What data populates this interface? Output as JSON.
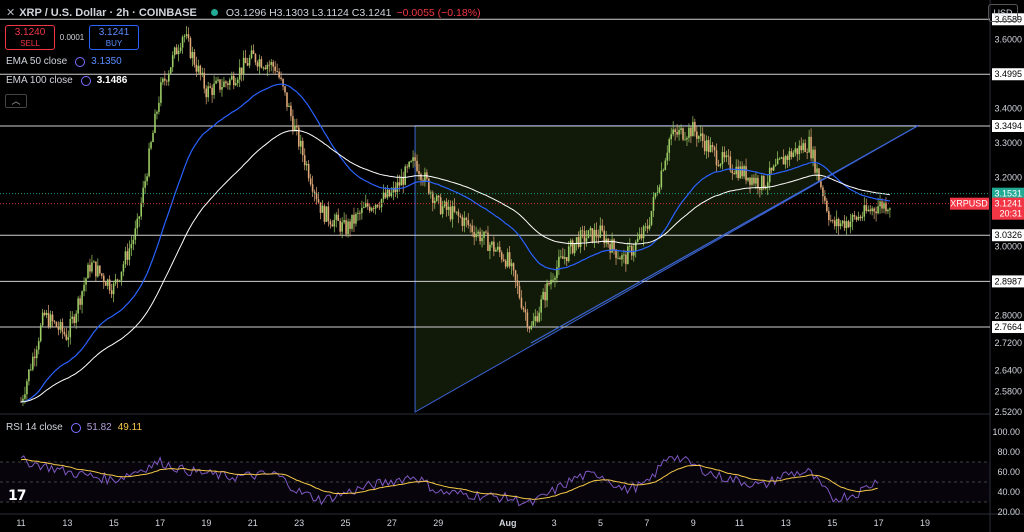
{
  "header": {
    "symbol": "XRP / U.S. Dollar · 2h · COINBASE",
    "ohlc": "O3.1296 H3.1303 L3.1124 C3.1241",
    "change": "−0.0055 (−0.18%)"
  },
  "trade": {
    "sell_price": "3.1240",
    "sell_label": "SELL",
    "spread": "0.0001",
    "buy_price": "3.1241",
    "buy_label": "BUY"
  },
  "indicators": {
    "ema50_label": "EMA 50 close",
    "ema50_value": "3.1350",
    "ema50_color": "#2962ff",
    "ema100_label": "EMA 100 close",
    "ema100_value": "3.1486",
    "ema100_color": "#ffffff"
  },
  "currency": "USD",
  "rsi": {
    "label": "RSI 14 close",
    "value": "51.82",
    "ma_value": "49.11",
    "line_color": "#7e57c2",
    "ma_color": "#f7c948"
  },
  "price_axis": {
    "ticks": [
      "3.6000",
      "3.5000",
      "3.4000",
      "3.3000",
      "3.2000",
      "3.1000",
      "3.0000",
      "2.9000",
      "2.8000",
      "2.7200",
      "2.6400",
      "2.5800",
      "2.5200"
    ],
    "levels": [
      "3.6589",
      "3.4995",
      "3.3494",
      "3.0326",
      "2.8987",
      "2.7664"
    ],
    "green_tag": "3.1531",
    "symbol_tag": "XRPUSD",
    "last_price": "3.1241",
    "countdown": "20:31"
  },
  "rsi_axis": {
    "ticks": [
      "100.00",
      "80.00",
      "60.00",
      "40.00",
      "20.00"
    ]
  },
  "time_axis": {
    "labels": [
      "11",
      "13",
      "15",
      "17",
      "19",
      "21",
      "23",
      "25",
      "27",
      "29",
      "Aug",
      "3",
      "5",
      "7",
      "9",
      "11",
      "13",
      "15",
      "17",
      "19"
    ]
  },
  "chart_data": {
    "type": "candlestick",
    "interval": "2h",
    "price_range": [
      2.52,
      3.68
    ],
    "horizontal_levels": [
      3.6589,
      3.4995,
      3.3494,
      3.0326,
      2.8987,
      2.7664
    ],
    "triangle": {
      "top_left": [
        "Jul 28",
        3.35
      ],
      "top_right": [
        "Aug 18",
        3.35
      ],
      "bottom_left": [
        "Jul 28",
        2.52
      ]
    },
    "trendline": {
      "from": [
        "Aug 2",
        2.72
      ],
      "to": [
        "Aug 18",
        3.35
      ]
    },
    "anchors": [
      [
        "Jul 11",
        2.55
      ],
      [
        "Jul 12",
        2.8
      ],
      [
        "Jul 13",
        2.74
      ],
      [
        "Jul 14",
        2.95
      ],
      [
        "Jul 15",
        2.88
      ],
      [
        "Jul 16",
        3.05
      ],
      [
        "Jul 17",
        3.45
      ],
      [
        "Jul 18",
        3.62
      ],
      [
        "Jul 19",
        3.45
      ],
      [
        "Jul 20",
        3.48
      ],
      [
        "Jul 21",
        3.55
      ],
      [
        "Jul 22",
        3.52
      ],
      [
        "Jul 23",
        3.3
      ],
      [
        "Jul 24",
        3.1
      ],
      [
        "Jul 25",
        3.05
      ],
      [
        "Jul 26",
        3.12
      ],
      [
        "Jul 27",
        3.15
      ],
      [
        "Jul 28",
        3.25
      ],
      [
        "Jul 29",
        3.12
      ],
      [
        "Jul 30",
        3.08
      ],
      [
        "Jul 31",
        3.02
      ],
      [
        "Aug 1",
        2.96
      ],
      [
        "Aug 2",
        2.76
      ],
      [
        "Aug 3",
        2.93
      ],
      [
        "Aug 4",
        3.02
      ],
      [
        "Aug 5",
        3.04
      ],
      [
        "Aug 6",
        2.96
      ],
      [
        "Aug 7",
        3.05
      ],
      [
        "Aug 8",
        3.32
      ],
      [
        "Aug 9",
        3.34
      ],
      [
        "Aug 10",
        3.26
      ],
      [
        "Aug 11",
        3.22
      ],
      [
        "Aug 12",
        3.18
      ],
      [
        "Aug 13",
        3.26
      ],
      [
        "Aug 14",
        3.3
      ],
      [
        "Aug 15",
        3.06
      ],
      [
        "Aug 16",
        3.08
      ],
      [
        "Aug 17",
        3.12
      ],
      [
        "Aug 17.5",
        3.1241
      ]
    ],
    "rsi_range": [
      20,
      100
    ],
    "rsi_anchors": [
      [
        "Jul 11",
        72
      ],
      [
        "Jul 13",
        60
      ],
      [
        "Jul 15",
        52
      ],
      [
        "Jul 17",
        70
      ],
      [
        "Jul 18",
        62
      ],
      [
        "Jul 20",
        55
      ],
      [
        "Jul 22",
        58
      ],
      [
        "Jul 23",
        40
      ],
      [
        "Jul 24",
        32
      ],
      [
        "Jul 26",
        46
      ],
      [
        "Jul 28",
        56
      ],
      [
        "Jul 29",
        40
      ],
      [
        "Aug 1",
        34
      ],
      [
        "Aug 2",
        28
      ],
      [
        "Aug 4",
        55
      ],
      [
        "Aug 5",
        58
      ],
      [
        "Aug 6",
        42
      ],
      [
        "Aug 7",
        48
      ],
      [
        "Aug 8",
        78
      ],
      [
        "Aug 10",
        56
      ],
      [
        "Aug 12",
        46
      ],
      [
        "Aug 13",
        58
      ],
      [
        "Aug 14",
        60
      ],
      [
        "Aug 15",
        33
      ],
      [
        "Aug 16",
        38
      ],
      [
        "Aug 17",
        52
      ]
    ]
  }
}
